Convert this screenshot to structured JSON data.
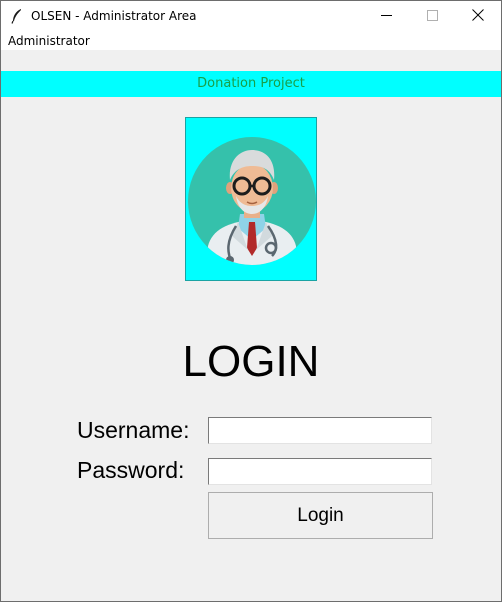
{
  "window": {
    "title": "OLSEN - Administrator Area",
    "icon": "feather-icon",
    "controls": [
      "minimize-icon",
      "maximize-icon",
      "close-icon"
    ]
  },
  "menubar": {
    "items": [
      {
        "label": "Administrator"
      }
    ]
  },
  "banner": {
    "text": "Donation Project",
    "background": "#00ffff",
    "text_color": "#18a048"
  },
  "avatar": {
    "icon": "doctor-avatar-icon",
    "frame_color": "#00ffff",
    "circle_color": "#35c1ab"
  },
  "login": {
    "heading": "LOGIN",
    "username_label": "Username:",
    "username_value": "",
    "password_label": "Password:",
    "password_value": "",
    "button_label": "Login"
  }
}
